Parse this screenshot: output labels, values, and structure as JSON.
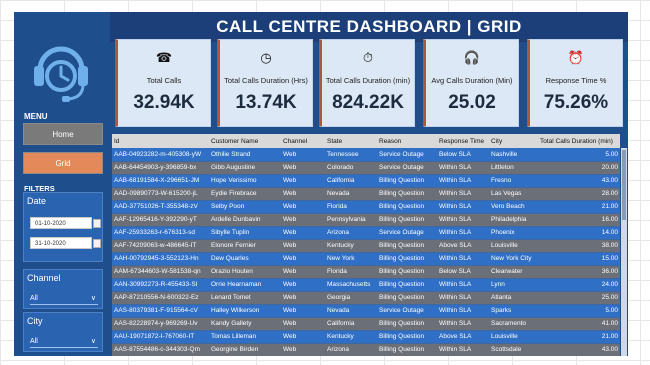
{
  "title": "CALL CENTRE DASHBOARD | GRID",
  "sidebar": {
    "menu_label": "MENU",
    "home_label": "Home",
    "grid_label": "Grid",
    "filters_label": "FILTERS",
    "date_label": "Date",
    "date_from": "01-10-2020",
    "date_to": "31-10-2020",
    "channel_label": "Channel",
    "channel_value": "All",
    "city_label": "City",
    "city_value": "All"
  },
  "kpis": [
    {
      "icon": "phone-icon",
      "label": "Total Calls",
      "value": "32.94K"
    },
    {
      "icon": "clock-icon",
      "label": "Total Calls Duration (Hrs)",
      "value": "13.74K"
    },
    {
      "icon": "timer-icon",
      "label": "Total Calls Duration (min)",
      "value": "824.22K"
    },
    {
      "icon": "headset-icon",
      "label": "Avg Calls Duration (Min)",
      "value": "25.02"
    },
    {
      "icon": "hand-clock-icon",
      "label": "Response Time %",
      "value": "75.26%"
    }
  ],
  "table": {
    "headers": [
      "Id",
      "Customer Name",
      "Channel",
      "State",
      "Reason",
      "Response Time",
      "City",
      "Total Calls Duration (min)"
    ],
    "rows": [
      [
        "AAB-04923282-m-405308-yW",
        "Othilie Strand",
        "Web",
        "Tennessee",
        "Service Outage",
        "Below SLA",
        "Nashville",
        "5.00"
      ],
      [
        "AAB-64454903-y-396859-bx",
        "Gibb Augustine",
        "Web",
        "Colorado",
        "Service Outage",
        "Within SLA",
        "Littleton",
        "20.00"
      ],
      [
        "AAB-68191584-X-296651-JM",
        "Hope Verissimo",
        "Web",
        "California",
        "Billing Question",
        "Within SLA",
        "Fresno",
        "43.00"
      ],
      [
        "AAD-09890773-W-615200-jL",
        "Eydie Firebrace",
        "Web",
        "Nevada",
        "Billing Question",
        "Within SLA",
        "Las Vegas",
        "28.00"
      ],
      [
        "AAD-37751026-T-355348-zV",
        "Selby Poon",
        "Web",
        "Florida",
        "Billing Question",
        "Within SLA",
        "Vero Beach",
        "21.00"
      ],
      [
        "AAF-12965416-Y-392290-yT",
        "Ardelle Dunbavin",
        "Web",
        "Pennsylvania",
        "Billing Question",
        "Within SLA",
        "Philadelphia",
        "16.00"
      ],
      [
        "AAF-25933263-r-676313-sd",
        "Sibylle Tuplin",
        "Web",
        "Arizona",
        "Service Outage",
        "Within SLA",
        "Phoenix",
        "14.00"
      ],
      [
        "AAF-74209063-w-486645-IT",
        "Elonore Fernier",
        "Web",
        "Kentucky",
        "Billing Question",
        "Above SLA",
        "Louisville",
        "38.00"
      ],
      [
        "AAH-00792945-3-552123-Hn",
        "Dew Quarles",
        "Web",
        "New York",
        "Billing Question",
        "Within SLA",
        "New York City",
        "15.00"
      ],
      [
        "AAM-67344603-W-581538-qn",
        "Orazio Houten",
        "Web",
        "Florida",
        "Billing Question",
        "Below SLA",
        "Clearwater",
        "36.00"
      ],
      [
        "AAN-30992273-R-455433-SI",
        "Orrie Hearnaman",
        "Web",
        "Massachusetts",
        "Billing Question",
        "Within SLA",
        "Lynn",
        "24.00"
      ],
      [
        "AAP-87210556-N-600322-Ez",
        "Lenard Tomet",
        "Web",
        "Georgia",
        "Billing Question",
        "Within SLA",
        "Atlanta",
        "25.00"
      ],
      [
        "AAS-80379381-F-915564-cV",
        "Halley Wilkerson",
        "Web",
        "Nevada",
        "Service Outage",
        "Within SLA",
        "Sparks",
        "5.00"
      ],
      [
        "AAS-82228974-y-969269-Uv",
        "Kandy Gallety",
        "Web",
        "California",
        "Billing Question",
        "Within SLA",
        "Sacramento",
        "41.00"
      ],
      [
        "AAU-19071872-I-767060-IT",
        "Tomas Lilleman",
        "Web",
        "Kentucky",
        "Billing Question",
        "Above SLA",
        "Louisville",
        "21.00"
      ],
      [
        "AAS-87554486-c-344303-Qm",
        "Georgine Birden",
        "Web",
        "Arizona",
        "Billing Question",
        "Within SLA",
        "Scottsdale",
        "43.00"
      ]
    ],
    "row_styles": [
      "blue",
      "gray",
      "blue",
      "gray",
      "blue",
      "gray",
      "blue",
      "gray",
      "blue",
      "gray",
      "blue",
      "gray",
      "blue",
      "gray",
      "blue",
      "gray"
    ]
  },
  "colors": {
    "dashboard_bg": "#1f4e8c",
    "kpi_bg": "#dce8f6",
    "grid_button": "#e3895a",
    "row_blue": "#2f6fc6",
    "row_gray": "#6b6f78"
  }
}
